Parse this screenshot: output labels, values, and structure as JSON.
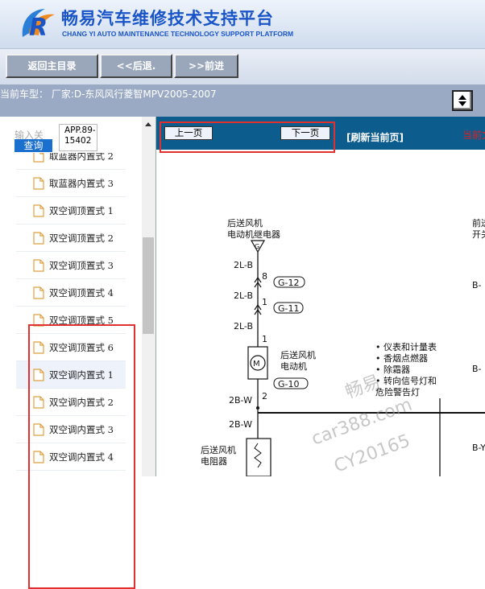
{
  "header": {
    "title": "畅易汽车维修技术支持平台",
    "subtitle": "CHANG YI AUTO MAINTENANCE TECHNOLOGY SUPPORT PLATFORM",
    "logo_icon": "logo-icon",
    "brand_color": "#1a55c8"
  },
  "toolbar": {
    "home_label": "返回主目录",
    "back_label": "<<后退.",
    "forward_label": ">>前进"
  },
  "car_bar": {
    "label": "当前车型：  厂家:D-东风风行菱智MPV2005-2007"
  },
  "sidebar": {
    "search_label": "输入关",
    "search_button": "查询",
    "search_value": "APP.89-15402",
    "items": [
      {
        "label": "取蓝器内置式 2",
        "icon": "document-icon"
      },
      {
        "label": "取蓝器内置式 3",
        "icon": "document-icon"
      },
      {
        "label": "双空调顶置式 1",
        "icon": "document-icon"
      },
      {
        "label": "双空调顶置式 2",
        "icon": "document-icon"
      },
      {
        "label": "双空调顶置式 3",
        "icon": "document-icon"
      },
      {
        "label": "双空调顶置式 4",
        "icon": "document-icon"
      },
      {
        "label": "双空调顶置式 5",
        "icon": "document-icon"
      },
      {
        "label": "双空调顶置式 6",
        "icon": "document-icon"
      },
      {
        "label": "双空调内置式 1",
        "icon": "document-icon"
      },
      {
        "label": "双空调内置式 2",
        "icon": "document-icon"
      },
      {
        "label": "双空调内置式 3",
        "icon": "document-icon"
      },
      {
        "label": "双空调内置式 4",
        "icon": "document-icon"
      }
    ],
    "selected_index": 8
  },
  "content": {
    "prev_page": "上一页",
    "next_page": "下一页",
    "refresh": "[刷新当前页]",
    "current_label": "当前文",
    "highlight_color": "#e03030",
    "nav_color": "#0d5c8e"
  },
  "diagram": {
    "relay_label_1": "后送风机",
    "relay_label_2": "电动机继电器",
    "wire_a": "2L-B",
    "wire_b": "2L-B",
    "wire_c": "2L-B",
    "pin_8": "8",
    "pin_1a": "1",
    "pin_1b": "1",
    "pin_2": "2",
    "conn_g12": "G-12",
    "conn_g11": "G-11",
    "conn_g10": "G-10",
    "conn_g": "G",
    "motor_label_1": "后送风机",
    "motor_label_2": "电动机",
    "wire_d": "2B-W",
    "wire_e": "2B-W",
    "resistor_label_1": "后送风机",
    "resistor_label_2": "电阻器",
    "list": [
      "• 仪表和计量表",
      "• 香烟点燃器",
      "• 除霜器",
      "• 转向信号灯和",
      "  危险警告灯"
    ],
    "right_label_1": "前送",
    "right_label_2": "开关",
    "right_wire_1": "B-",
    "right_wire_2": "B-",
    "right_wire_3": "B-Y",
    "watermark_1": "畅易",
    "watermark_2": "car388.com",
    "watermark_3": "CY20165"
  }
}
